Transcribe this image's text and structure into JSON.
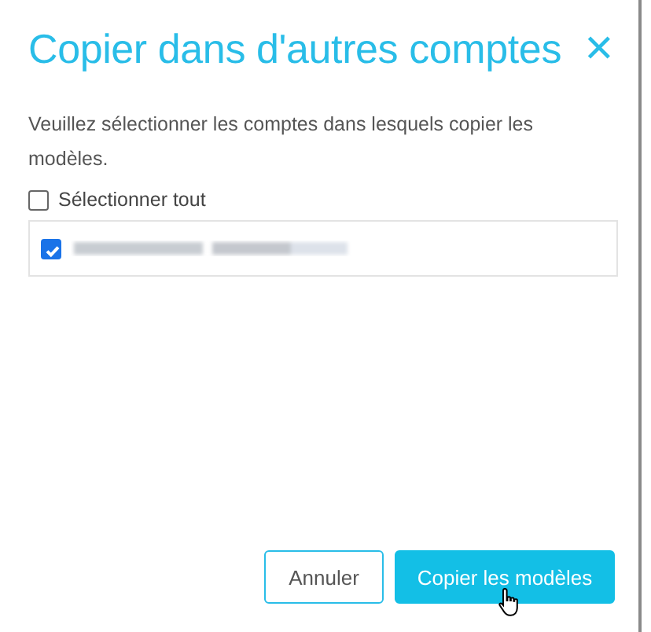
{
  "dialog": {
    "title": "Copier dans d'autres comptes",
    "close_icon": "✕",
    "instructions": "Veuillez sélectionner les comptes dans lesquels copier les modèles.",
    "select_all": {
      "label": "Sélectionner tout",
      "checked": false
    },
    "accounts": [
      {
        "checked": true
      }
    ],
    "buttons": [
      {
        "label": "Annuler",
        "kind": "secondary"
      },
      {
        "label": "Copier les modèles",
        "kind": "primary"
      }
    ]
  }
}
